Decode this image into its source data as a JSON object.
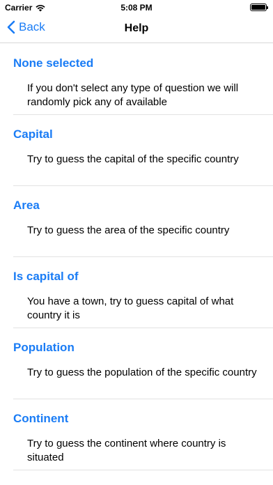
{
  "status_bar": {
    "carrier": "Carrier",
    "time": "5:08 PM"
  },
  "nav": {
    "back_label": "Back",
    "title": "Help"
  },
  "sections": [
    {
      "title": "None selected",
      "description": "If you don't select any type of question we will randomly pick any of available"
    },
    {
      "title": "Capital",
      "description": "Try to guess the capital of the specific country"
    },
    {
      "title": "Area",
      "description": "Try to guess the area of the specific country"
    },
    {
      "title": "Is capital of",
      "description": "You have a town, try to guess capital of what country it is"
    },
    {
      "title": "Population",
      "description": "Try to guess the population of the specific country"
    },
    {
      "title": "Continent",
      "description": "Try to guess the continent where country is situated"
    }
  ],
  "colors": {
    "accent": "#1a7cf5",
    "separator": "#e2e2e2"
  }
}
